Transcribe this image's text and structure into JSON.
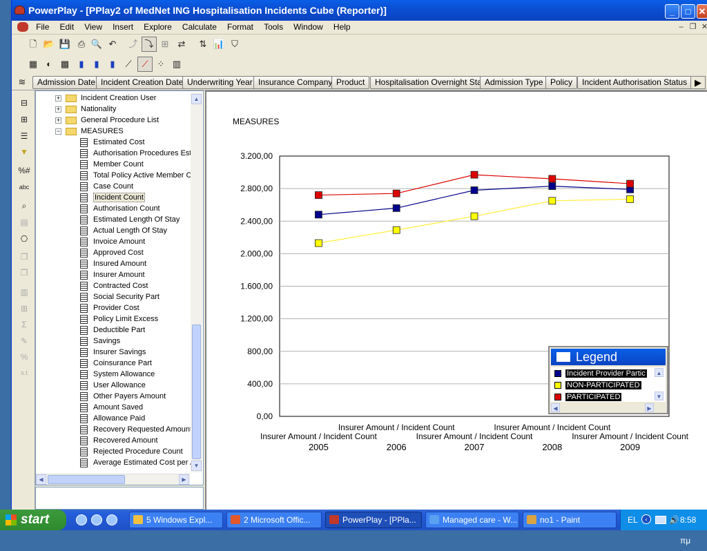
{
  "window": {
    "title": "PowerPlay - [PPlay2 of MedNet ING Hospitalisation Incidents Cube (Reporter)]",
    "buttons": {
      "minimize": "_",
      "maximize": "□",
      "close": "✕"
    }
  },
  "menu": [
    "File",
    "Edit",
    "View",
    "Insert",
    "Explore",
    "Calculate",
    "Format",
    "Tools",
    "Window",
    "Help"
  ],
  "mdi_buttons": [
    "–",
    "❐",
    "✕"
  ],
  "dimensions": [
    "Admission Date",
    "Incident Creation Date",
    "Underwriting Year",
    "Insurance Company",
    "Product",
    "Hospitalisation Overnight Stay",
    "Admission Type",
    "Policy",
    "Incident Authorisation Status"
  ],
  "tree": {
    "folders": [
      {
        "label": "Incident Creation User",
        "expander": "+"
      },
      {
        "label": "Nationality",
        "expander": "+"
      },
      {
        "label": "General Procedure List",
        "expander": "+"
      },
      {
        "label": "MEASURES",
        "expander": "−"
      }
    ],
    "measures": [
      "Estimated Cost",
      "Authorisation Procedures Estir",
      "Member Count",
      "Total Policy Active Member Co",
      "Case Count",
      "Incident Count",
      "Authorisation Count",
      "Estimated Length Of Stay",
      "Actual Length Of Stay",
      "Invoice Amount",
      "Approved Cost",
      "Insured Amount",
      "Insurer Amount",
      "Contracted Cost",
      "Social Security Part",
      "Provider Cost",
      "Policy Limit Excess",
      "Deductible Part",
      "Savings",
      "Insurer Savings",
      "Coinsurance Part",
      "System Allowance",
      "User Allowance",
      "Other Payers Amount",
      "Amount Saved",
      "Allowance Paid",
      "Recovery Requested Amount",
      "Recovered Amount",
      "Rejected Procedure Count",
      "Average Estimated Cost per A"
    ],
    "selected": "Incident Count"
  },
  "chart_heading": "MEASURES",
  "chart_data": {
    "type": "line",
    "x": [
      "2005",
      "2006",
      "2007",
      "2008",
      "2009"
    ],
    "x_sublabels": [
      "Insurer Amount  /  Incident Count",
      "Insurer Amount  /  Incident Count",
      "Insurer Amount  /  Incident Count",
      "Insurer Amount  /  Incident Count",
      "Insurer Amount  /  Incident Count"
    ],
    "yticks": [
      "0,00",
      "400,00",
      "800,00",
      "1.200,00",
      "1.600,00",
      "2.000,00",
      "2.400,00",
      "2.800,00",
      "3.200,00"
    ],
    "ylim": [
      0,
      3200
    ],
    "grid": true,
    "series": [
      {
        "name": "Incident Provider Partic",
        "color": "#00008b",
        "values": [
          2480,
          2560,
          2780,
          2830,
          2790
        ]
      },
      {
        "name": "NON-PARTICIPATED",
        "color": "#ffff00",
        "line_color": "#ffee33",
        "values": [
          2130,
          2290,
          2460,
          2650,
          2670
        ]
      },
      {
        "name": "PARTICIPATED",
        "color": "#dd0000",
        "values": [
          2720,
          2740,
          2970,
          2920,
          2860
        ]
      }
    ],
    "legend_title": "Legend",
    "legend_position": "bottom-right"
  },
  "taskbar": {
    "start": "start",
    "tasks": [
      {
        "label": "5 Windows Expl...",
        "active": false
      },
      {
        "label": "2 Microsoft Offic...",
        "active": false
      },
      {
        "label": "PowerPlay - [PPla...",
        "active": true
      },
      {
        "label": "Managed care - W...",
        "active": false
      },
      {
        "label": "no1 - Paint",
        "active": false
      }
    ],
    "language": "EL",
    "clock": "8:58 πμ"
  }
}
